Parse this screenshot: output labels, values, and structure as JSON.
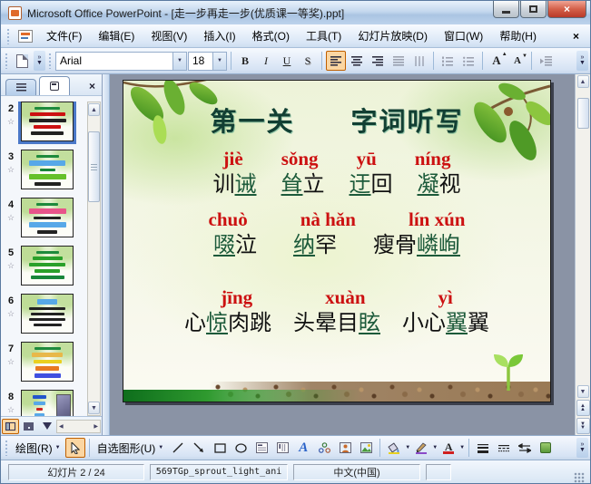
{
  "window": {
    "title": "Microsoft Office PowerPoint - [走一步再走一步(优质课一等奖).ppt]"
  },
  "icons": {
    "dropdown": "▼",
    "chevron": "»",
    "up": "▲",
    "down": "▼",
    "left": "◀",
    "right": "▶",
    "star": "☆",
    "close": "×"
  },
  "menu": {
    "items": [
      "文件(F)",
      "编辑(E)",
      "视图(V)",
      "插入(I)",
      "格式(O)",
      "工具(T)",
      "幻灯片放映(D)",
      "窗口(W)",
      "帮助(H)"
    ],
    "close": "×"
  },
  "format_toolbar": {
    "font_name": "Arial",
    "font_size": "18",
    "bold": "B",
    "italic": "I",
    "underline": "U",
    "shadow": "S",
    "grow_font": "A",
    "shrink_font": "A"
  },
  "slides_panel": {
    "thumbnails": [
      {
        "number": "2",
        "selected": true,
        "bars": [
          [
            "#1e8a3c",
            55,
            3
          ],
          [
            "#cc1111",
            78,
            4
          ],
          [
            "#222222",
            82,
            4
          ],
          [
            "#cc1111",
            60,
            4
          ],
          [
            "#222222",
            72,
            4
          ]
        ]
      },
      {
        "number": "3",
        "selected": false,
        "bars": [
          [
            "#1e8a3c",
            50,
            3
          ],
          [
            "#57a8e8",
            80,
            6
          ],
          [
            "#18863a",
            34,
            4
          ],
          [
            "#66c02a",
            82,
            6
          ],
          [
            "#222222",
            58,
            4
          ]
        ]
      },
      {
        "number": "4",
        "selected": false,
        "bars": [
          [
            "#1e8a3c",
            48,
            3
          ],
          [
            "#e8548a",
            82,
            6
          ],
          [
            "#222222",
            60,
            4
          ],
          [
            "#57a8e8",
            82,
            6
          ],
          [
            "#222222",
            44,
            4
          ]
        ]
      },
      {
        "number": "5",
        "selected": false,
        "bars": [
          [
            "#1e8a3c",
            50,
            3
          ],
          [
            "#2aa02a",
            66,
            4
          ],
          [
            "#2aa02a",
            80,
            4
          ],
          [
            "#2aa02a",
            56,
            4
          ],
          [
            "#18863a",
            74,
            4
          ]
        ]
      },
      {
        "number": "6",
        "selected": false,
        "bars": [
          [
            "#57a8e8",
            44,
            6
          ],
          [
            "#222222",
            80,
            3
          ],
          [
            "#222222",
            74,
            3
          ],
          [
            "#222222",
            80,
            3
          ],
          [
            "#222222",
            62,
            3
          ]
        ]
      },
      {
        "number": "7",
        "selected": false,
        "bars": [
          [
            "#1e8a3c",
            58,
            3
          ],
          [
            "#e8b84a",
            68,
            5
          ],
          [
            "#ead020",
            62,
            5
          ],
          [
            "#e87a22",
            52,
            5
          ],
          [
            "#4050e0",
            58,
            5
          ]
        ]
      },
      {
        "number": "8",
        "selected": false,
        "image": true,
        "bars": [
          [
            "#2255cc",
            46,
            4
          ],
          [
            "#57a8e8",
            40,
            4
          ],
          [
            "#cc2222",
            22,
            3
          ],
          [
            "#57a8e8",
            36,
            4
          ],
          [
            "#2255cc",
            30,
            4
          ]
        ]
      }
    ]
  },
  "slide": {
    "title": "第一关　　字词听写",
    "colors": {
      "pinyin": "#cc1111",
      "marked": "#1c5a3a",
      "text": "#111111",
      "title": "#123f33"
    },
    "groups": [
      {
        "pinyin": [
          "jiè",
          "sǒng",
          "yū",
          "níng"
        ],
        "words": [
          [
            [
              "训",
              0
            ],
            [
              "诫",
              1
            ]
          ],
          [
            [
              "耸",
              1
            ],
            [
              "立",
              0
            ]
          ],
          [
            [
              "迂",
              1
            ],
            [
              "回",
              0
            ]
          ],
          [
            [
              "凝",
              1
            ],
            [
              "视",
              0
            ]
          ]
        ]
      },
      {
        "pinyin": [
          "chuò",
          "nà hǎn",
          "lín xún"
        ],
        "words": [
          [
            [
              "啜",
              1
            ],
            [
              "泣",
              0
            ]
          ],
          [
            [
              "纳",
              1
            ],
            [
              "罕",
              0
            ]
          ],
          [
            [
              "瘦骨",
              0
            ],
            [
              "嶙峋",
              1
            ]
          ]
        ]
      },
      {
        "pinyin": [
          "jīng",
          "xuàn",
          "yì"
        ],
        "words": [
          [
            [
              "心",
              0
            ],
            [
              "惊",
              1
            ],
            [
              "肉跳",
              0
            ]
          ],
          [
            [
              "头晕目",
              0
            ],
            [
              "眩",
              1
            ]
          ],
          [
            [
              "小心",
              0
            ],
            [
              "翼",
              1
            ],
            [
              "翼",
              0
            ]
          ]
        ]
      }
    ]
  },
  "drawing_toolbar": {
    "draw_label": "绘图(R)",
    "autoshapes_label": "自选图形(U)",
    "wordart_letter": "A",
    "font_color_letter": "A"
  },
  "status_bar": {
    "slide_indicator": "幻灯片 2 / 24",
    "design_template": "569TGp_sprout_light_ani",
    "language": "中文(中国)"
  }
}
